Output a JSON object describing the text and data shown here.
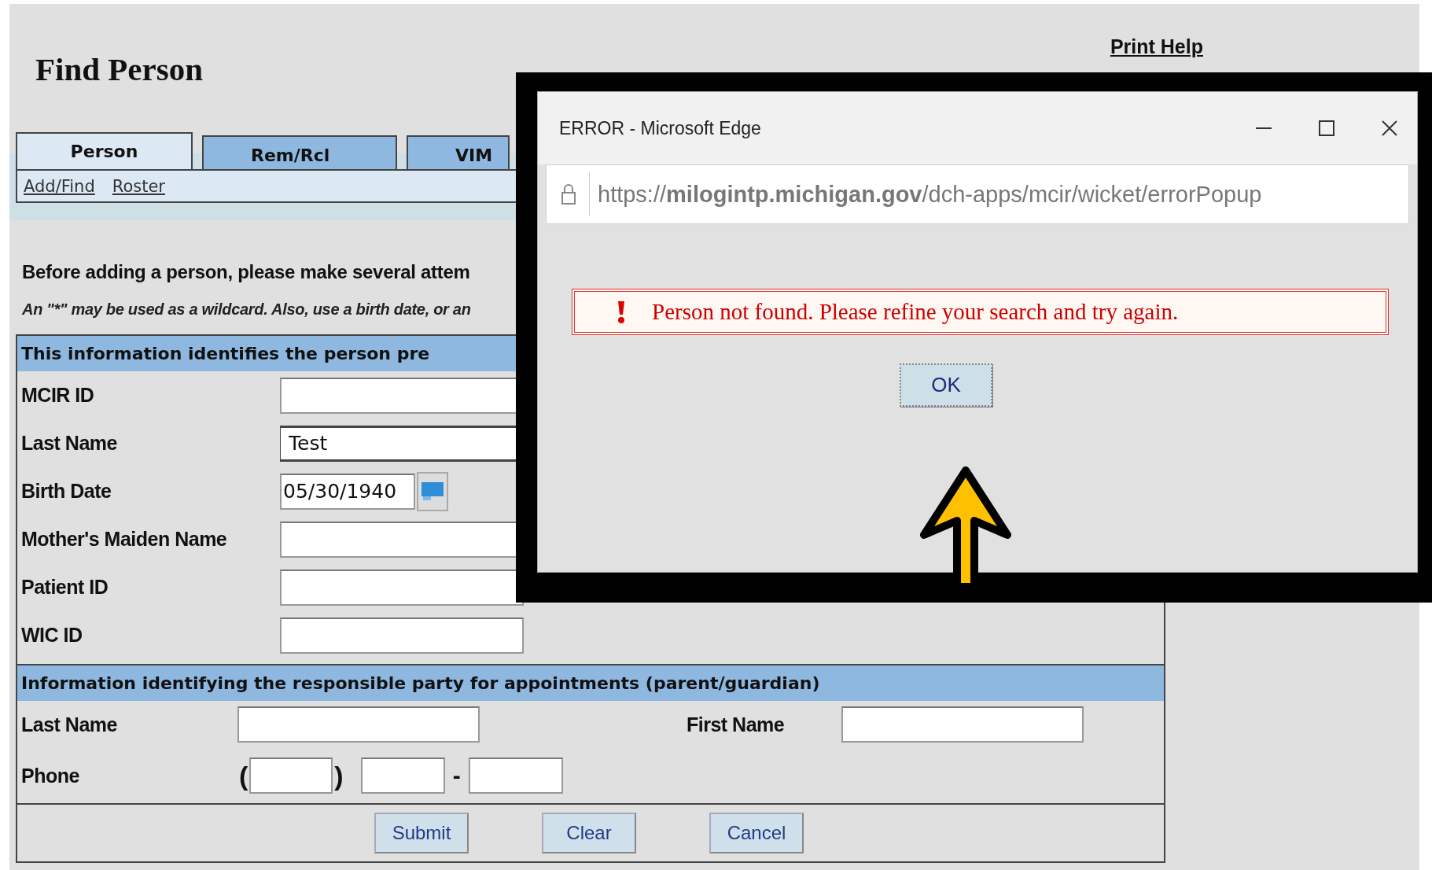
{
  "page": {
    "title": "Find Person",
    "print_help": "Print Help"
  },
  "tabs": [
    {
      "label": "Person",
      "selected": true
    },
    {
      "label": "Rem/Rcl",
      "selected": false
    },
    {
      "label": "VIM",
      "selected": false
    }
  ],
  "subnav": [
    "Add/Find",
    "Roster"
  ],
  "instructions": {
    "main": "Before adding a person, please make several attem",
    "hint": "An \"*\" may be used as a wildcard. Also, use a birth date, or an"
  },
  "person_section": {
    "heading": "This information identifies the person pre",
    "fields": [
      {
        "label": "MCIR ID",
        "kind": "text"
      },
      {
        "label": "Last Name",
        "kind": "text",
        "value": "Test"
      },
      {
        "label": "Birth Date",
        "kind": "date",
        "value": "05/30/1940"
      },
      {
        "label": "Mother's Maiden Name",
        "kind": "text"
      },
      {
        "label": "Patient ID",
        "kind": "text"
      },
      {
        "label": "WIC ID",
        "kind": "text"
      }
    ]
  },
  "guardian_section": {
    "heading": "Information identifying the responsible party for appointments (parent/guardian)",
    "last_name_label": "Last Name",
    "first_name_label": "First Name",
    "phone_label": "Phone",
    "phone_open": "(",
    "phone_close": ")",
    "phone_dash": "-"
  },
  "buttons": [
    "Submit",
    "Clear",
    "Cancel"
  ],
  "error_dialog": {
    "title": "ERROR - Microsoft Edge",
    "url": "https://**milogintp.michigan.gov**/dch-apps/mcir/wicket/errorPopup",
    "message": "Person not found. Please refine your search and try again.",
    "button": "OK"
  }
}
